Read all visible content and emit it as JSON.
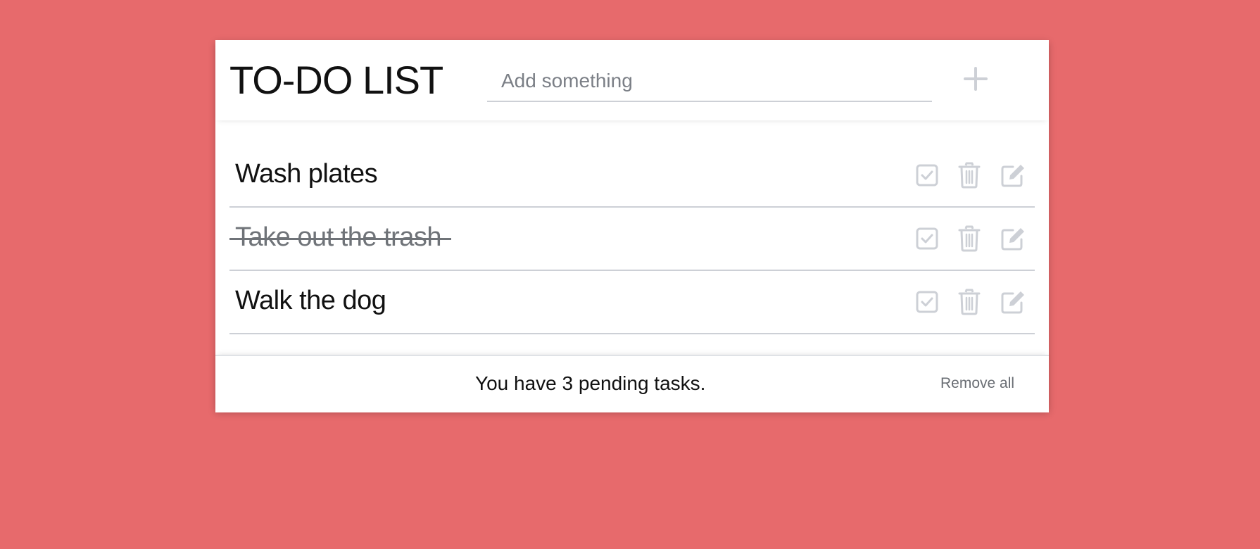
{
  "header": {
    "title": "TO-DO LIST",
    "input_placeholder": "Add something",
    "input_value": "",
    "add_icon": "plus-icon"
  },
  "tasks": [
    {
      "text": "Wash plates",
      "completed": false
    },
    {
      "text": "Take out the trash",
      "completed": true
    },
    {
      "text": "Walk the dog",
      "completed": false
    }
  ],
  "task_action_icons": [
    "check-square-icon",
    "trash-icon",
    "edit-icon"
  ],
  "footer": {
    "status": "You have 3 pending tasks.",
    "remove_all": "Remove all"
  },
  "colors": {
    "background": "#e76a6c",
    "card": "#ffffff",
    "icon": "#cdd0d6",
    "text": "#111111",
    "muted_text": "#6f7378"
  }
}
